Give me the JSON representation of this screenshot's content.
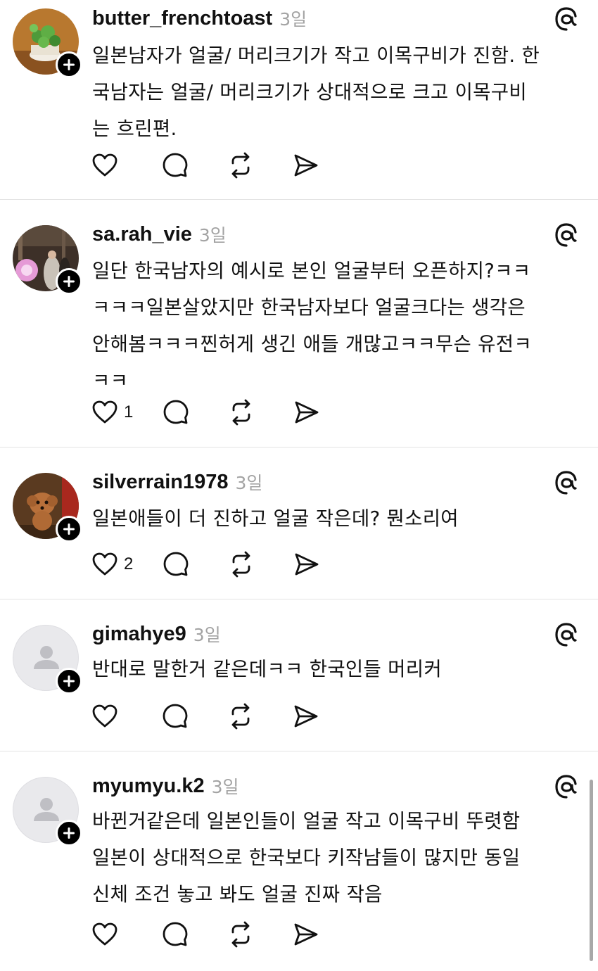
{
  "app": "Threads",
  "colors": {
    "text": "#111111",
    "muted": "#a3a3a3",
    "divider": "#e3e3e3",
    "badge": "#000000"
  },
  "icons": {
    "follow": "plus-icon",
    "brand": "threads-logo-icon",
    "like": "heart-icon",
    "reply": "comment-bubble-icon",
    "repost": "repost-icon",
    "share": "send-icon"
  },
  "posts": [
    {
      "username": "butter_frenchtoast",
      "time": "3일",
      "avatar": "photo-plant",
      "lines": [
        "일본남자가 얼굴/ 머리크기가 작고 이목구비가 진함. 한",
        "국남자는 얼굴/ 머리크기가 상대적으로 크고 이목구비",
        "는 흐린편."
      ],
      "likes": ""
    },
    {
      "username": "sa.rah_vie",
      "time": "3일",
      "avatar": "photo-wedding",
      "lines": [
        "일단 한국남자의 예시로 본인 얼굴부터 오픈하지?ㅋㅋ",
        "ㅋㅋㅋ일본살았지만 한국남자보다 얼굴크다는 생각은",
        "안해봄ㅋㅋㅋ찐허게 생긴 애들 개많고ㅋㅋ무슨 유전ㅋ",
        "ㅋㅋ"
      ],
      "likes": "1"
    },
    {
      "username": "silverrain1978",
      "time": "3일",
      "avatar": "photo-dog",
      "lines": [
        "일본애들이 더 진하고 얼굴 작은데? 뭔소리여"
      ],
      "likes": "2"
    },
    {
      "username": "gimahye9",
      "time": "3일",
      "avatar": "default",
      "lines": [
        "반대로 말한거 같은데ㅋㅋ 한국인들 머리커"
      ],
      "likes": ""
    },
    {
      "username": "myumyu.k2",
      "time": "3일",
      "avatar": "default",
      "lines": [
        "바뀐거같은데 일본인들이 얼굴 작고 이목구비 뚜렷함",
        "일본이 상대적으로 한국보다 키작남들이 많지만 동일",
        "신체 조건 놓고 봐도 얼굴 진짜 작음"
      ],
      "likes": ""
    }
  ]
}
